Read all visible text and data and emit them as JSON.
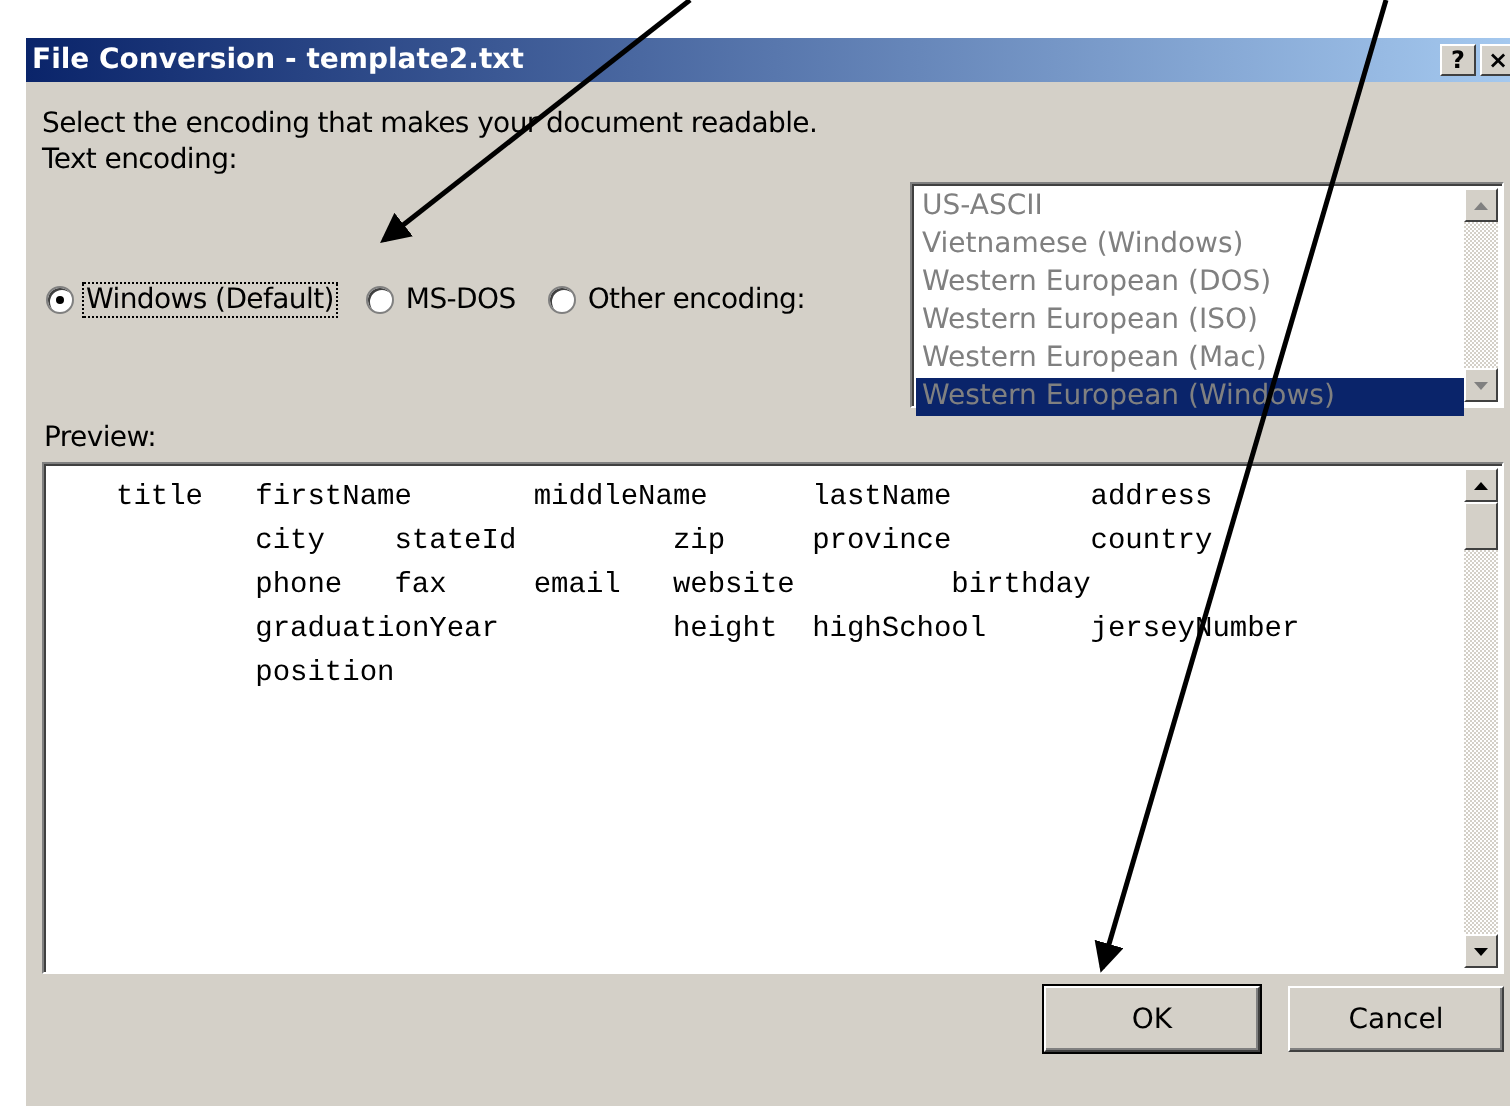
{
  "window": {
    "title": "File Conversion - template2.txt",
    "title_buttons": [
      "?",
      "×"
    ]
  },
  "instruction": "Select the encoding that makes your document readable.",
  "encoding_label": "Text encoding:",
  "encoding_options": [
    {
      "label": "Windows (Default)",
      "selected": true,
      "focused": true
    },
    {
      "label": "MS-DOS",
      "selected": false,
      "focused": false
    },
    {
      "label": "Other encoding:",
      "selected": false,
      "focused": false
    }
  ],
  "encoding_list": {
    "disabled": true,
    "items": [
      {
        "label": "US-ASCII",
        "selected": false
      },
      {
        "label": "Vietnamese (Windows)",
        "selected": false
      },
      {
        "label": "Western European (DOS)",
        "selected": false
      },
      {
        "label": "Western European (ISO)",
        "selected": false
      },
      {
        "label": "Western European (Mac)",
        "selected": false
      },
      {
        "label": "Western European (Windows)",
        "selected": true
      }
    ]
  },
  "preview": {
    "label": "Preview:",
    "lines": [
      "title\tfirstName\tmiddleName\tlastName\taddress",
      "\tcity\tstateId\t\tzip\tprovince\tcountry",
      "\tphone\tfax\temail\twebsite\t\tbirthday",
      "\tgraduationYear\t\theight\thighSchool\tjerseyNumber",
      "\tposition"
    ]
  },
  "buttons": [
    {
      "label": "OK",
      "default": true
    },
    {
      "label": "Cancel",
      "default": false
    }
  ]
}
